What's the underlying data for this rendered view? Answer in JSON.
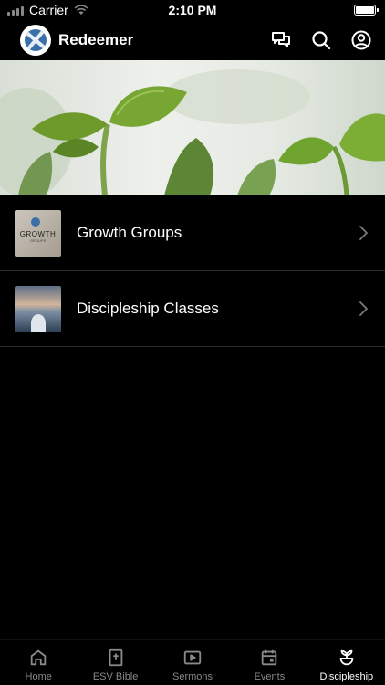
{
  "status_bar": {
    "carrier": "Carrier",
    "time": "2:10 PM"
  },
  "header": {
    "title": "Redeemer",
    "icons": [
      "chat-icon",
      "search-icon",
      "profile-icon"
    ]
  },
  "list": {
    "items": [
      {
        "label": "Growth Groups",
        "thumb_title": "GROWTH",
        "thumb_subtitle": "GROUPS"
      },
      {
        "label": "Discipleship Classes"
      }
    ]
  },
  "tabs": [
    {
      "label": "Home",
      "icon": "home-icon",
      "active": false
    },
    {
      "label": "ESV Bible",
      "icon": "bible-icon",
      "active": false
    },
    {
      "label": "Sermons",
      "icon": "play-icon",
      "active": false
    },
    {
      "label": "Events",
      "icon": "calendar-icon",
      "active": false
    },
    {
      "label": "Discipleship",
      "icon": "sprout-icon",
      "active": true
    }
  ],
  "colors": {
    "background": "#000000",
    "inactive_tab": "#8a8a8a",
    "active_tab": "#ffffff",
    "divider": "#2a2a2a"
  }
}
